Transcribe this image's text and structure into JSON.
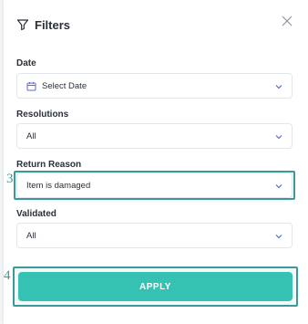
{
  "header": {
    "title": "Filters"
  },
  "fields": {
    "date": {
      "label": "Date",
      "value": "Select Date"
    },
    "resolutions": {
      "label": "Resolutions",
      "value": "All"
    },
    "return_reason": {
      "label": "Return Reason",
      "value": "Item is damaged"
    },
    "validated": {
      "label": "Validated",
      "value": "All"
    }
  },
  "apply_label": "APPLY",
  "annotations": {
    "step_3": "3",
    "step_4": "4"
  },
  "colors": {
    "accent": "#35c2b2",
    "annotation": "#3b9a99",
    "chevron": "#5b6bd6"
  }
}
